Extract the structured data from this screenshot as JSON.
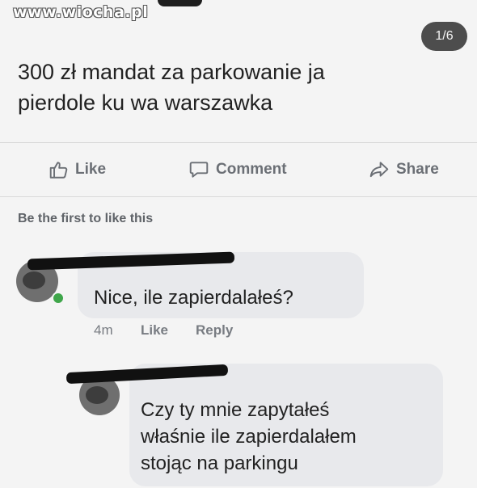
{
  "watermark": "www.wiocha.pl",
  "pager": "1/6",
  "post": {
    "line1": "300 zł mandat za parkowanie ja",
    "line2": "pierdole ku  wa warszawka"
  },
  "actions": {
    "like": "Like",
    "comment": "Comment",
    "share": "Share"
  },
  "reactions_summary": "Be the first to like this",
  "comments": [
    {
      "text": "Nice, ile zapierdalałeś?",
      "time": "4m",
      "like": "Like",
      "reply": "Reply"
    },
    {
      "line1": "Czy ty mnie zapytałeś",
      "line2": "właśnie ile zapierdalałem",
      "line3": "stojąc na parkingu"
    }
  ]
}
